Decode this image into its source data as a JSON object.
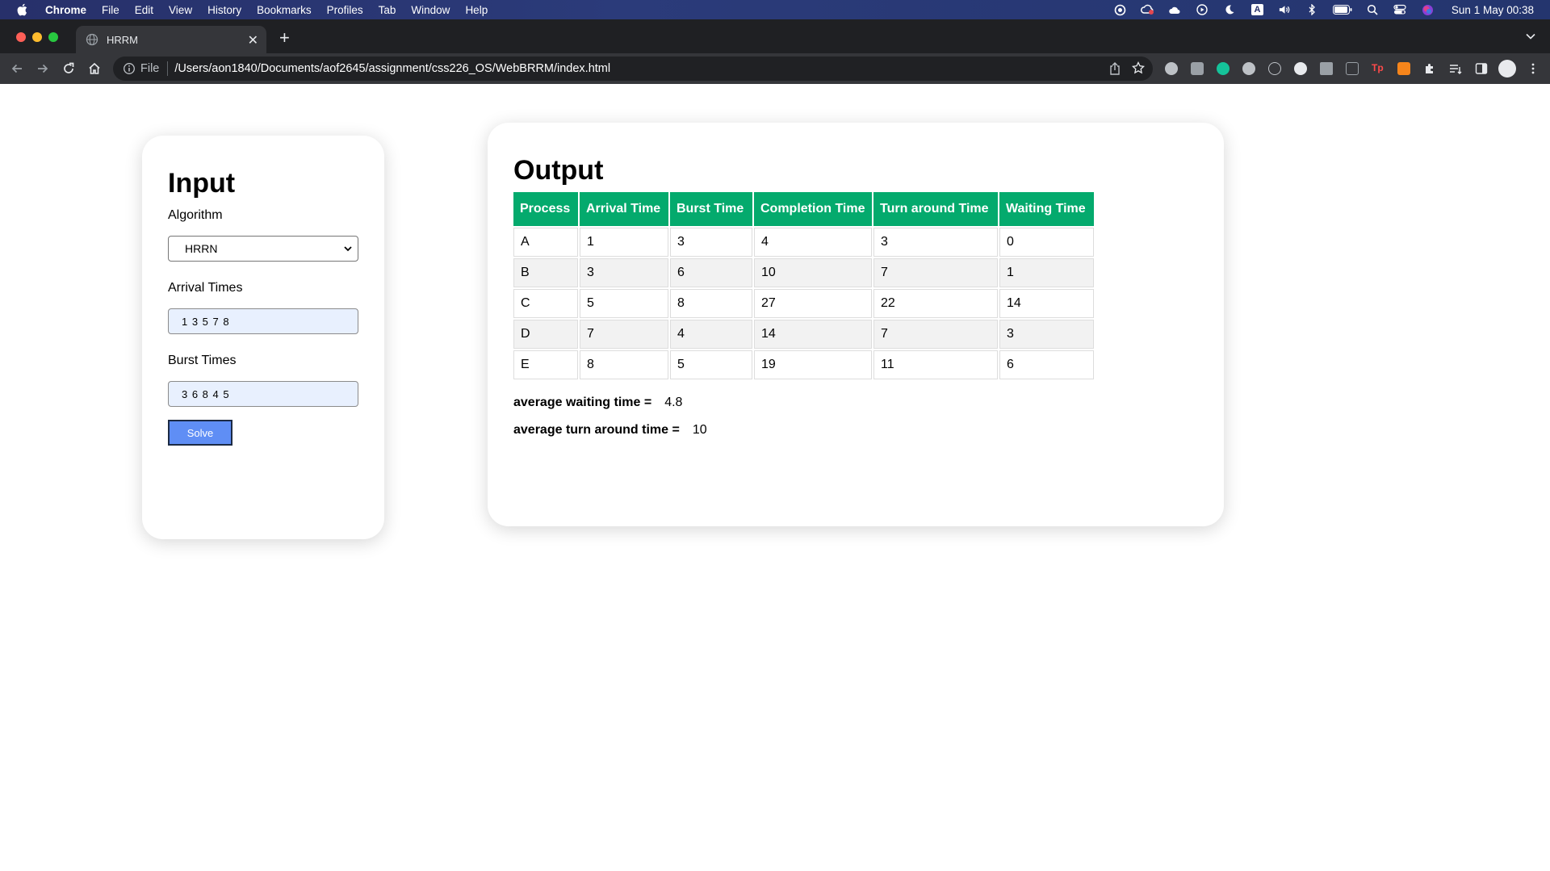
{
  "menubar": {
    "app": "Chrome",
    "items": [
      "File",
      "Edit",
      "View",
      "History",
      "Bookmarks",
      "Profiles",
      "Tab",
      "Window",
      "Help"
    ],
    "status_icons": [
      "focus-icon",
      "creative-cloud-icon",
      "weather-icon",
      "play-icon",
      "moon-icon",
      "input-source-icon",
      "volume-icon",
      "bluetooth-icon",
      "battery-icon",
      "spotlight-icon",
      "control-center-icon",
      "siri-icon"
    ],
    "input_source": "A",
    "clock": "Sun 1 May  00:38"
  },
  "browser": {
    "tab_title": "HRRM",
    "scheme_label": "File",
    "url": "/Users/aon1840/Documents/aof2645/assignment/css226_OS/WebBRRM/index.html"
  },
  "input": {
    "title": "Input",
    "algorithm_label": "Algorithm",
    "algorithm_value": "HRRN",
    "arrival_label": "Arrival Times",
    "arrival_value": "1 3 5 7 8",
    "burst_label": "Burst Times",
    "burst_value": "3 6 8 4 5",
    "solve_label": "Solve"
  },
  "output": {
    "title": "Output",
    "headers": [
      "Process",
      "Arrival Time",
      "Burst Time",
      "Completion Time",
      "Turn around Time",
      "Waiting Time"
    ],
    "rows": [
      [
        "A",
        "1",
        "3",
        "4",
        "3",
        "0"
      ],
      [
        "B",
        "3",
        "6",
        "10",
        "7",
        "1"
      ],
      [
        "C",
        "5",
        "8",
        "27",
        "22",
        "14"
      ],
      [
        "D",
        "7",
        "4",
        "14",
        "7",
        "3"
      ],
      [
        "E",
        "8",
        "5",
        "19",
        "11",
        "6"
      ]
    ],
    "avg_waiting_label": "average waiting time =",
    "avg_waiting_value": "4.8",
    "avg_turnaround_label": "average turn around time =",
    "avg_turnaround_value": "10"
  },
  "colors": {
    "table_header": "#04aa6d",
    "solve_button": "#5f8ef5",
    "input_fill": "#e8f0fe"
  }
}
